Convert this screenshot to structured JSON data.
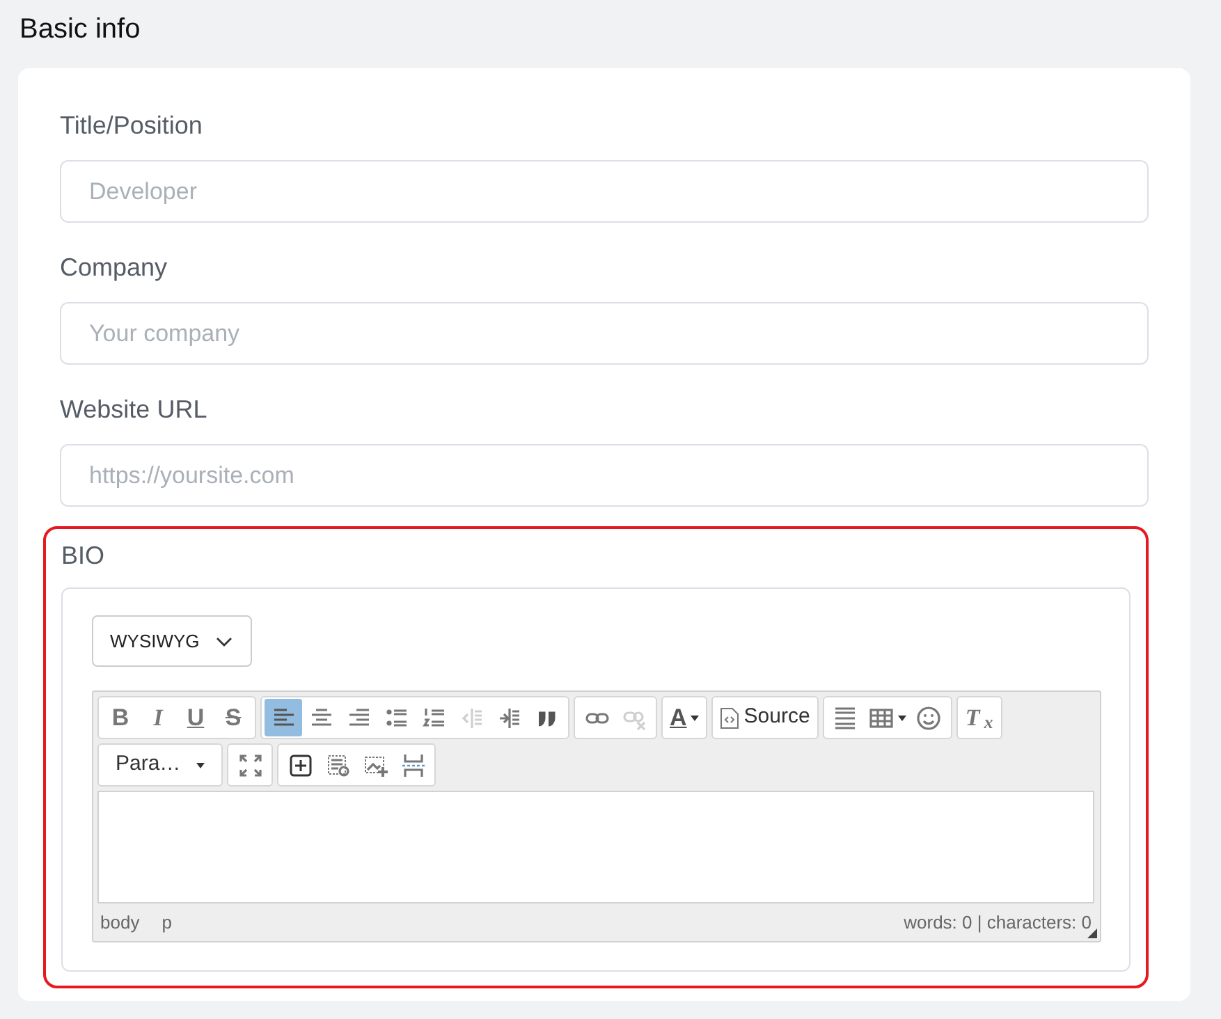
{
  "heading": "Basic info",
  "fields": [
    {
      "label": "Title/Position",
      "placeholder": "Developer"
    },
    {
      "label": "Company",
      "placeholder": "Your company"
    },
    {
      "label": "Website URL",
      "placeholder": "https://yoursite.com"
    }
  ],
  "bio": {
    "label": "BIO",
    "invalid": true,
    "mode_select": {
      "value": "WYSIWYG"
    },
    "editor": {
      "toolbar_rows": [
        [
          [
            {
              "kind": "bold",
              "label": "B",
              "selected": false,
              "disabled": false
            },
            {
              "kind": "italic",
              "label": "I",
              "selected": false,
              "disabled": false
            },
            {
              "kind": "underline",
              "label": "U",
              "selected": false,
              "disabled": false
            },
            {
              "kind": "strike",
              "label": "S",
              "selected": false,
              "disabled": false
            }
          ],
          [
            {
              "kind": "icon",
              "selected": true,
              "disabled": false
            },
            {
              "kind": "icon",
              "selected": false,
              "disabled": false
            },
            {
              "kind": "icon",
              "selected": false,
              "disabled": false
            },
            {
              "kind": "icon",
              "selected": false,
              "disabled": false
            },
            {
              "kind": "icon",
              "selected": false,
              "disabled": false
            },
            {
              "kind": "icon",
              "selected": false,
              "disabled": true
            },
            {
              "kind": "icon",
              "selected": false,
              "disabled": false
            },
            {
              "kind": "icon",
              "selected": false,
              "disabled": false
            }
          ],
          [
            {
              "kind": "icon",
              "selected": false,
              "disabled": false
            },
            {
              "kind": "icon",
              "selected": false,
              "disabled": true
            }
          ],
          [
            {
              "kind": "text-color",
              "label": "A",
              "selected": false,
              "disabled": false
            }
          ],
          [
            {
              "kind": "source",
              "label": "Source",
              "selected": false,
              "disabled": false
            }
          ],
          [
            {
              "kind": "icon",
              "selected": false,
              "disabled": false
            },
            {
              "kind": "icon-menu",
              "selected": false,
              "disabled": false
            },
            {
              "kind": "icon",
              "selected": false,
              "disabled": false
            }
          ],
          [
            {
              "kind": "clear",
              "label": "T$_{x}$",
              "selected": false,
              "disabled": false
            }
          ]
        ],
        [
          [
            {
              "kind": "format",
              "label": "Para…",
              "selected": false,
              "disabled": false
            }
          ],
          [
            {
              "kind": "icon",
              "selected": false,
              "disabled": false
            }
          ],
          [
            {
              "kind": "icon",
              "selected": false,
              "disabled": false
            },
            {
              "kind": "icon",
              "selected": false,
              "disabled": false
            },
            {
              "kind": "icon",
              "selected": false,
              "disabled": false
            },
            {
              "kind": "icon",
              "selected": false,
              "disabled": false
            }
          ]
        ]
      ],
      "path": [
        "body",
        "p"
      ],
      "counter": "words: 0 | characters: 0"
    }
  }
}
